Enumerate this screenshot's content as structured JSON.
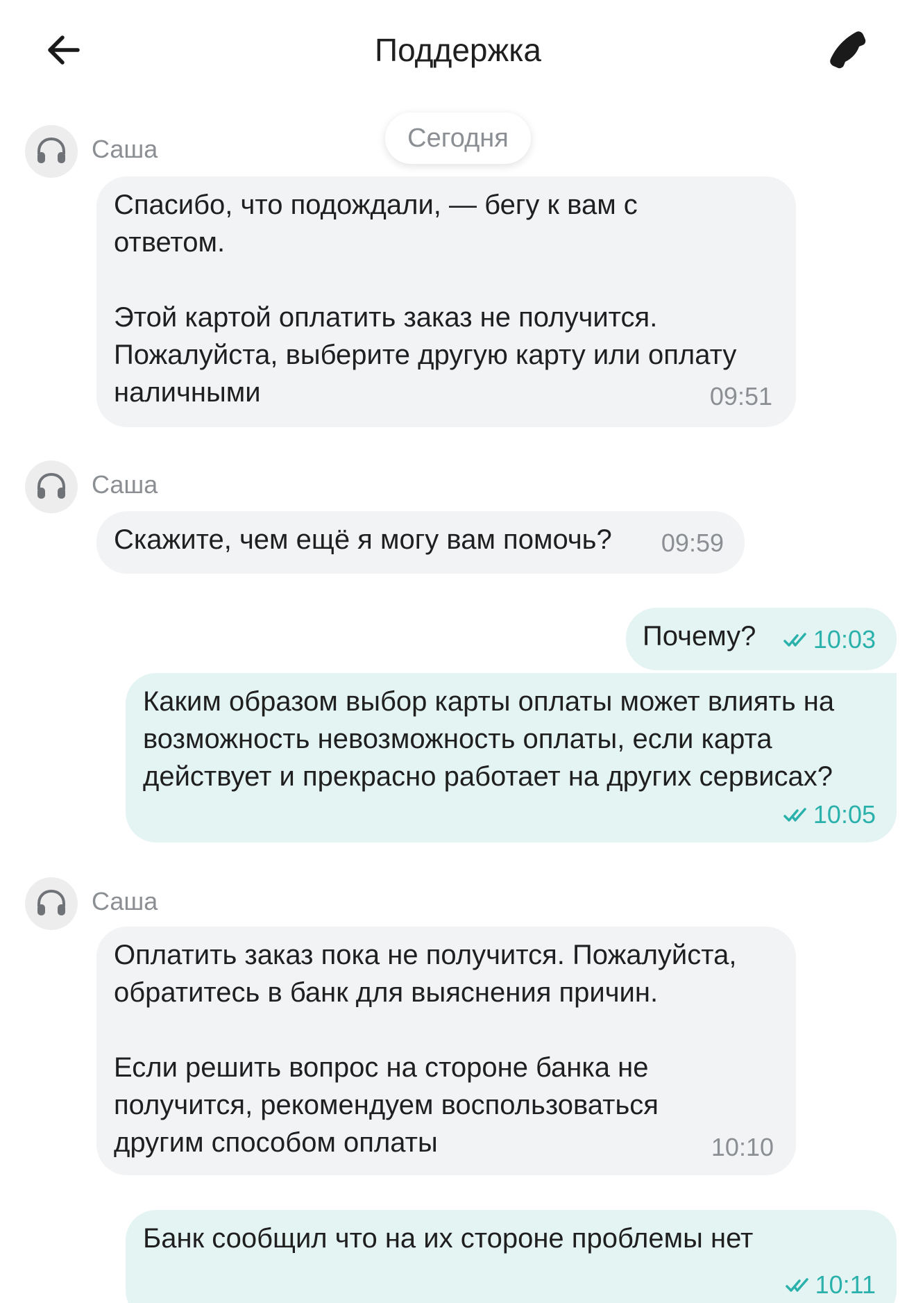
{
  "header": {
    "title": "Поддержка",
    "back_icon": "arrow-left-icon",
    "call_icon": "phone-icon"
  },
  "date_divider": "Сегодня",
  "colors": {
    "incoming_bubble": "#f2f3f5",
    "outgoing_bubble": "#e4f4f3",
    "outgoing_time": "#2bb1ab",
    "muted_text": "#8b8e93"
  },
  "messages": [
    {
      "sender": "Саша",
      "direction": "incoming",
      "paragraphs": [
        "Спасибо, что подождали, — бегу к вам с ответом.",
        "Этой картой оплатить заказ не получится. Пожалуйста, выберите другую карту или оплату наличными"
      ],
      "time": "09:51"
    },
    {
      "sender": "Саша",
      "direction": "incoming",
      "text": "Скажите, чем ещё я могу вам помочь?",
      "time": "09:59"
    },
    {
      "direction": "outgoing",
      "text": "Почему?",
      "time": "10:03",
      "status_icon": "double-check-icon"
    },
    {
      "direction": "outgoing",
      "text": "Каким образом выбор карты оплаты может влиять на возможность невозможность оплаты, если карта действует и прекрасно работает на других сервисах?",
      "time": "10:05",
      "status_icon": "double-check-icon"
    },
    {
      "sender": "Саша",
      "direction": "incoming",
      "paragraphs": [
        "Оплатить заказ пока не получится. Пожалуйста, обратитесь в банк для выяснения причин.",
        "Если решить вопрос на стороне банка не получится, рекомендуем воспользоваться другим способом оплаты"
      ],
      "time": "10:10"
    },
    {
      "direction": "outgoing",
      "text": "Банк сообщил что на их стороне проблемы нет",
      "time": "10:11",
      "status_icon": "double-check-icon"
    }
  ]
}
